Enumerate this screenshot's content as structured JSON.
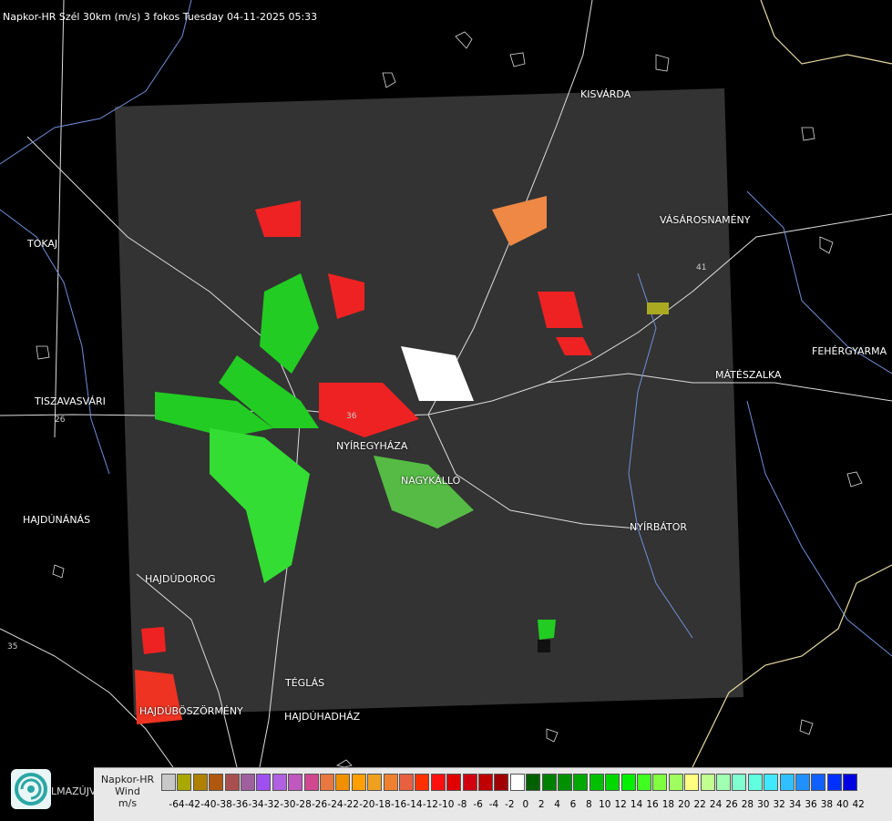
{
  "header": {
    "title": "Napkor-HR Szél 30km (m/s) 3 fokos Tuesday 04-11-2025 05:33"
  },
  "map": {
    "towns": [
      {
        "id": "kisvarda",
        "name": "KISVÁRDA"
      },
      {
        "id": "tokaj",
        "name": "TOKAJ"
      },
      {
        "id": "vasarosnameny",
        "name": "VÁSÁROSNAMÉNY"
      },
      {
        "id": "fehergyarmat",
        "name": "FEHÉRGYARMA"
      },
      {
        "id": "mateszalka",
        "name": "MÁTÉSZALKA"
      },
      {
        "id": "tiszavasvari",
        "name": "TISZAVASVÁRI"
      },
      {
        "id": "nyiregyhaza",
        "name": "NYÍREGYHÁZA"
      },
      {
        "id": "nagykallo",
        "name": "NAGYKÁLLÓ"
      },
      {
        "id": "hajdunanas",
        "name": "HAJDÚNÁNÁS"
      },
      {
        "id": "nyirbator",
        "name": "NYÍRBÁTOR"
      },
      {
        "id": "hajdudorog",
        "name": "HAJDÚDOROG"
      },
      {
        "id": "teglas",
        "name": "TÉGLÁS"
      },
      {
        "id": "hajduboszormeny",
        "name": "HAJDÚBÖSZÖRMÉNY"
      },
      {
        "id": "hajduhadhaz",
        "name": "HAJDÚHADHÁZ"
      }
    ],
    "road_labels": {
      "r26": "26",
      "r35": "35",
      "r41": "41",
      "r36": "36"
    }
  },
  "legend": {
    "line1": "Napkor-HR",
    "line2": "Wind",
    "line3": "m/s",
    "ticks": [
      "-64",
      "-42",
      "-40",
      "-38",
      "-36",
      "-34",
      "-32",
      "-30",
      "-28",
      "-26",
      "-24",
      "-22",
      "-20",
      "-18",
      "-16",
      "-14",
      "-12",
      "-10",
      "-8",
      "-6",
      "-4",
      "-2",
      "0",
      "2",
      "4",
      "6",
      "8",
      "10",
      "12",
      "14",
      "16",
      "18",
      "20",
      "22",
      "24",
      "26",
      "28",
      "30",
      "32",
      "34",
      "36",
      "38",
      "40",
      "42"
    ],
    "colors": [
      "#c8c8c8",
      "#a8a800",
      "#b08000",
      "#b05810",
      "#a85050",
      "#a060a0",
      "#a050f0",
      "#b060e0",
      "#c058c0",
      "#d04890",
      "#e87840",
      "#f09000",
      "#ffa000",
      "#f0a020",
      "#f08030",
      "#e86040",
      "#ff3000",
      "#ff1010",
      "#e00000",
      "#d00010",
      "#c00000",
      "#a00000",
      "#ffffff",
      "#006000",
      "#008000",
      "#009000",
      "#00a800",
      "#00c000",
      "#00d800",
      "#00f000",
      "#40ff20",
      "#80ff40",
      "#a0ff60",
      "#ffff80",
      "#c0ff90",
      "#a0ffb0",
      "#80ffd0",
      "#60ffe0",
      "#40e8ff",
      "#30c0ff",
      "#2090ff",
      "#1060ff",
      "#0030ff",
      "#0000e0"
    ]
  },
  "logo": {
    "text": "LMAZÚJVÁR"
  }
}
